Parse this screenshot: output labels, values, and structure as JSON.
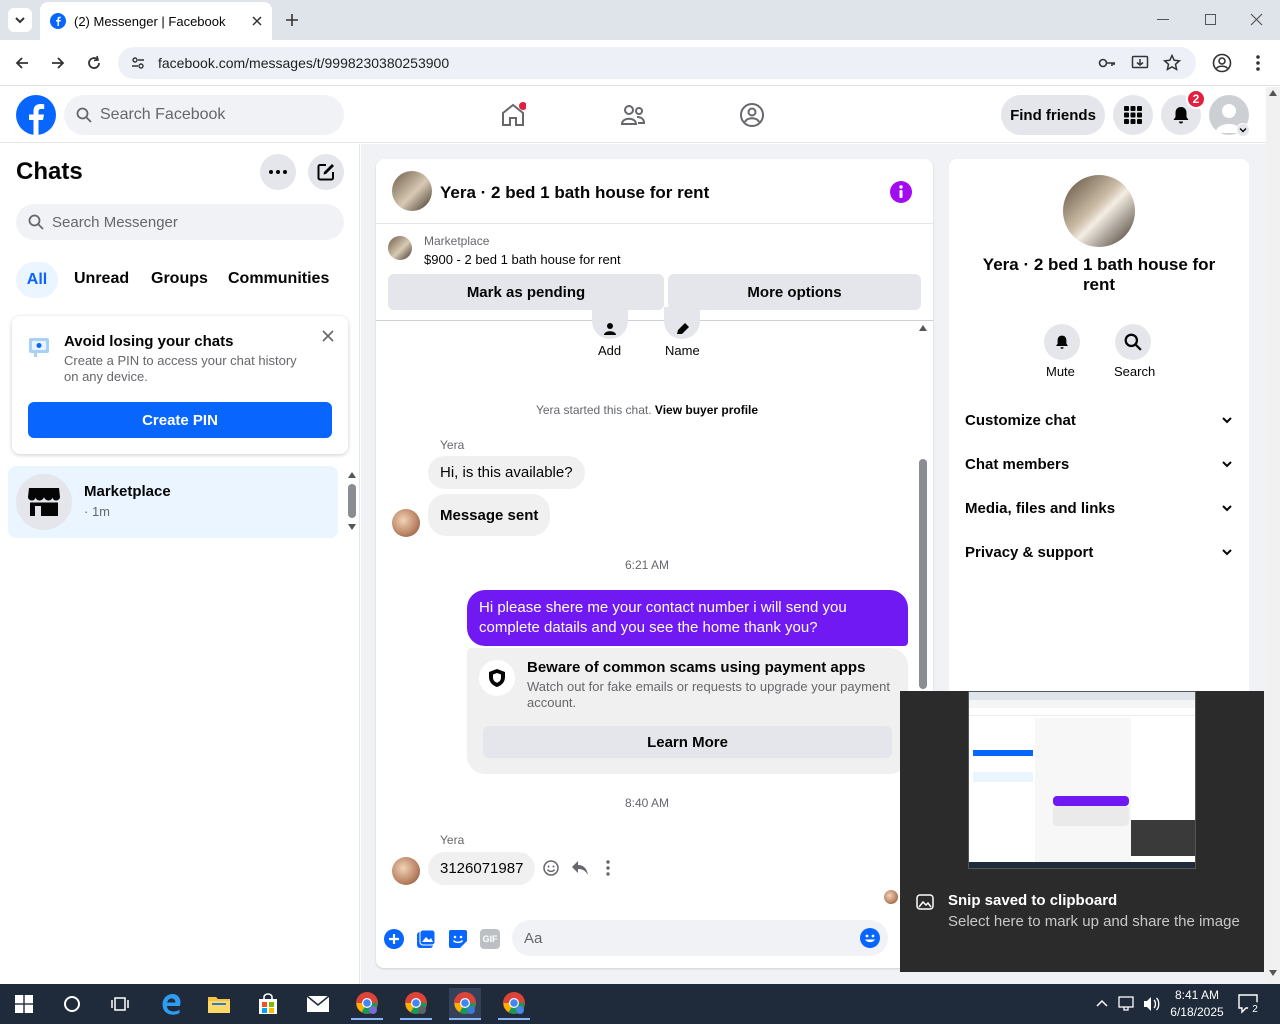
{
  "browser": {
    "tab_title": "(2) Messenger | Facebook",
    "url": "facebook.com/messages/t/9998230380253900"
  },
  "fb": {
    "search_placeholder": "Search Facebook",
    "find_friends": "Find friends",
    "notif_count": "2"
  },
  "chats": {
    "title": "Chats",
    "search_placeholder": "Search Messenger",
    "filters": [
      "All",
      "Unread",
      "Groups",
      "Communities"
    ],
    "pin_card": {
      "title": "Avoid losing your chats",
      "body": "Create a PIN to access your chat history on any device.",
      "button": "Create PIN"
    },
    "list": [
      {
        "name": "Marketplace",
        "meta": "· 1m"
      }
    ]
  },
  "conversation": {
    "header_title": "Yera · 2 bed 1 bath house for rent",
    "listing_label": "Marketplace",
    "listing_title": "$900 - 2 bed 1 bath house for rent",
    "mark_pending": "Mark as pending",
    "more_options": "More options",
    "add_label": "Add",
    "name_label": "Name",
    "started_text": "Yera started this chat.",
    "buyer_profile": "View buyer profile",
    "sender": "Yera",
    "msg1": "Hi, is this available?",
    "msg2": "Message sent",
    "time1": "6:21 AM",
    "out_msg": "Hi please shere me your contact number i will send you complete datails and you see the home thank you?",
    "scam_title": "Beware of common scams using payment apps",
    "scam_body": "Watch out for fake emails or requests to upgrade your payment account.",
    "learn_more": "Learn More",
    "time2": "8:40 AM",
    "sender2": "Yera",
    "msg3": "3126071987",
    "composer_placeholder": "Aa"
  },
  "info": {
    "title": "Yera · 2 bed 1 bath house for rent",
    "mute": "Mute",
    "search": "Search",
    "sections": [
      "Customize chat",
      "Chat members",
      "Media, files and links",
      "Privacy & support"
    ]
  },
  "toast": {
    "title": "Snip saved to clipboard",
    "body": "Select here to mark up and share the image"
  },
  "taskbar": {
    "time": "8:41 AM",
    "date": "6/18/2025",
    "notif": "2"
  },
  "colors": {
    "fb_blue": "#0866ff",
    "messenger_purple": "#7119f2",
    "notif_red": "#e41e3f"
  }
}
